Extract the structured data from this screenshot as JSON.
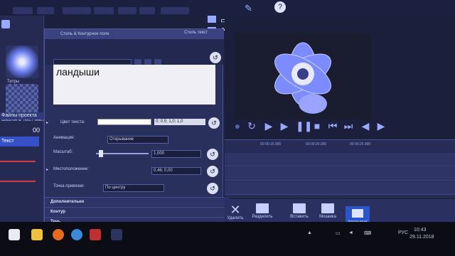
{
  "window": {
    "help_icon": "question-icon"
  },
  "sidebar": {
    "item1_label": "Титры",
    "item2_label": "Шаблон & Текст Мастер",
    "project_files": "Файлы проекта",
    "counter": "00",
    "text_item": "Текст"
  },
  "props": {
    "header_left": "Стиль & Контурное поле",
    "header_right": "Стиль текст",
    "text_content": "ландыши",
    "text_color_label": "Цвет текста:",
    "text_color_value": "0; 0,5; 1,0; 1,0",
    "animation_label": "Анимация:",
    "animation_value": "Открывание",
    "scale_label": "Масштаб:",
    "scale_value": "1,000",
    "position_label": "Местоположение:",
    "position_value": "0,46; 0,00",
    "anchor_label": "Точка привязки:",
    "anchor_value": "По центру",
    "section_extra": "Дополнительно",
    "section_outline": "Контур",
    "section_shadow": "Тень"
  },
  "timeline": {
    "ticks": [
      "00:00:15.000",
      "00:00:20.000",
      "00:00:25.000"
    ]
  },
  "toolbar": {
    "delete": "Удалить",
    "split": "Разделить",
    "insert": "Вставить",
    "tile": "Мозаика",
    "autodetect": "Автосдвиг"
  },
  "taskbar": {
    "lang": "РУС",
    "time": "10:43",
    "date": "29.11.2018"
  },
  "colors": {
    "accent": "#3650c8",
    "flower": "#7c8cff"
  }
}
